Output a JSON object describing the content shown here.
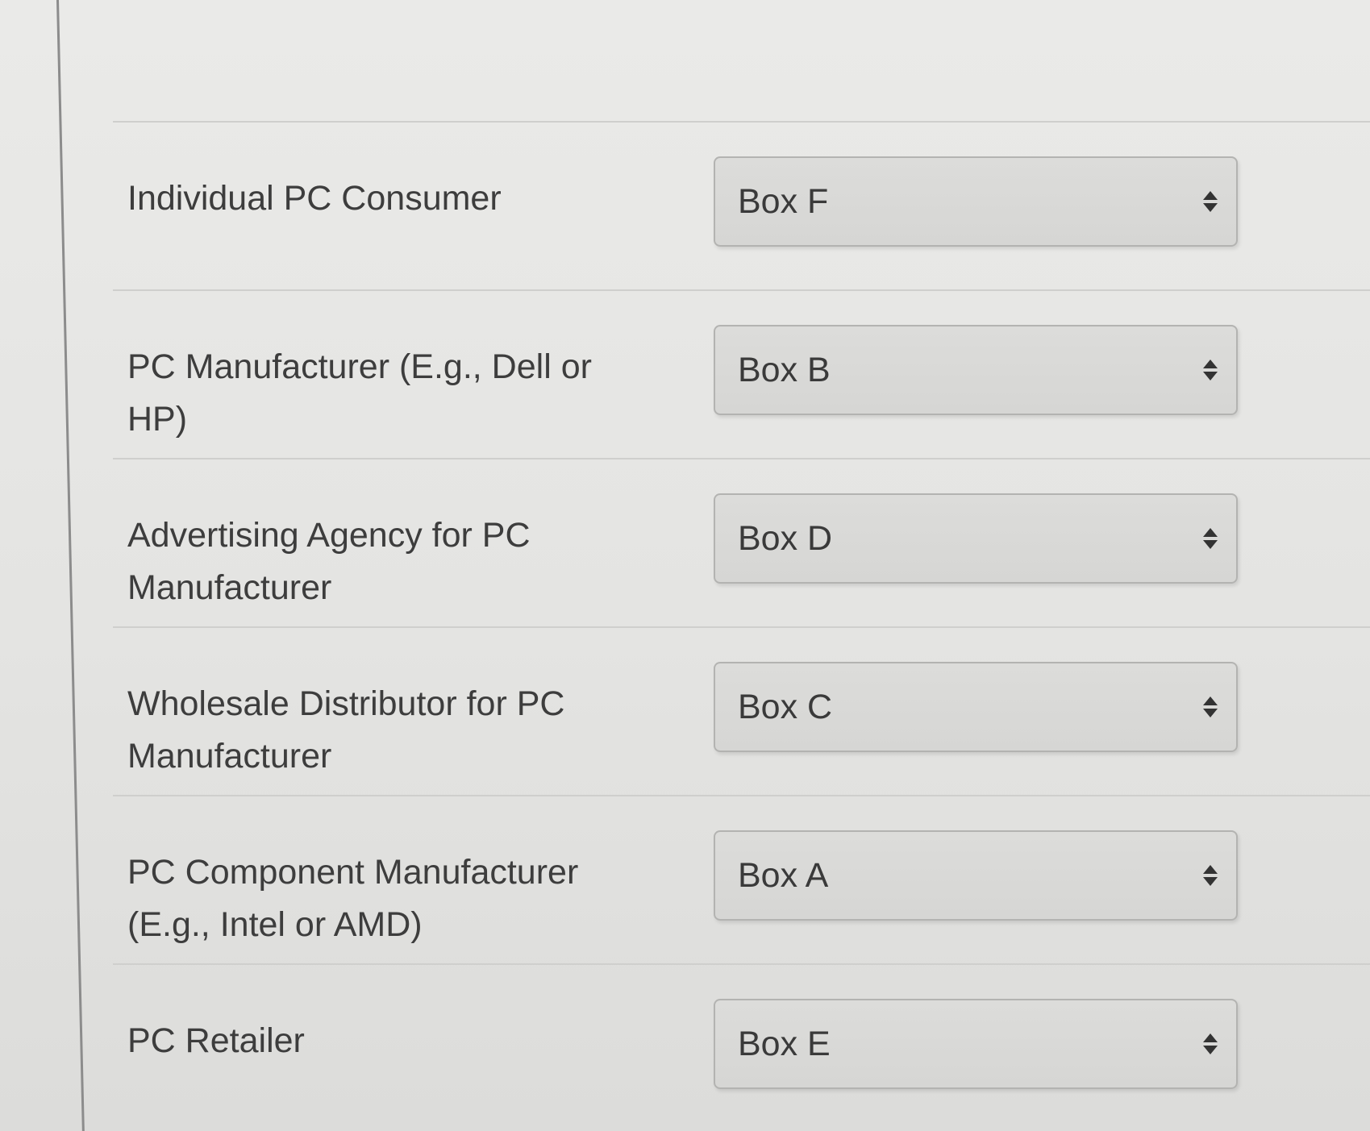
{
  "rows": [
    {
      "label": "Individual PC Consumer",
      "selected": "Box F"
    },
    {
      "label": "PC Manufacturer (E.g., Dell or HP)",
      "selected": "Box B"
    },
    {
      "label": "Advertising Agency for PC Manufacturer",
      "selected": "Box D"
    },
    {
      "label": "Wholesale Distributor for PC Manufacturer",
      "selected": "Box C"
    },
    {
      "label": "PC Component Manufacturer (E.g., Intel or AMD)",
      "selected": "Box A"
    },
    {
      "label": "PC Retailer",
      "selected": "Box E"
    }
  ],
  "icons": {
    "select_arrows": "up-down-arrows-icon"
  }
}
